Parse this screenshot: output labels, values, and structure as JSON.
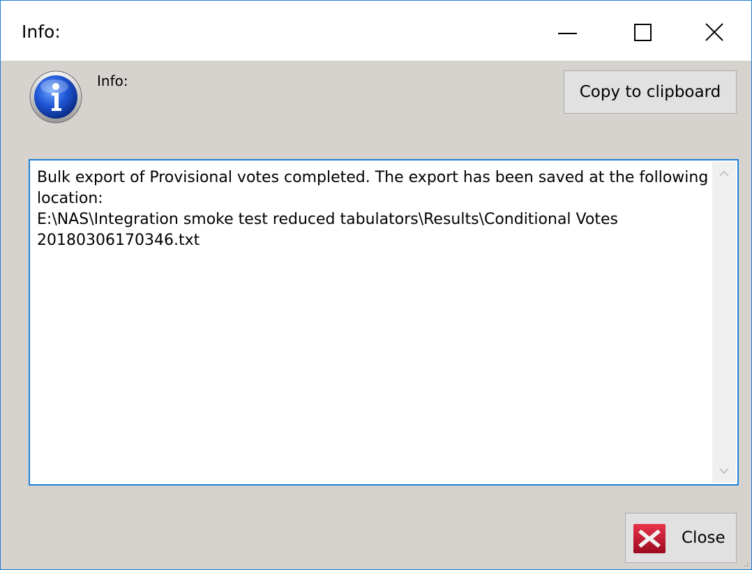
{
  "window": {
    "title": "Info:"
  },
  "window_controls": {
    "minimize_icon": "minimize-icon",
    "maximize_icon": "maximize-icon",
    "close_icon": "close-icon"
  },
  "header": {
    "icon": "info-icon",
    "label": "Info:"
  },
  "toolbar": {
    "copy_label": "Copy to clipboard"
  },
  "message": {
    "text": "Bulk export of Provisional votes completed. The export has been saved at the following location:\nE:\\NAS\\Integration smoke test reduced tabulators\\Results\\Conditional Votes 20180306170346.txt"
  },
  "footer": {
    "close_icon": "red-x-icon",
    "close_label": "Close"
  },
  "colors": {
    "accent": "#1e7fd6",
    "dialog_bg": "#d6d3ce",
    "button_bg": "#e1e1e1",
    "close_icon_red": "#c8102e"
  }
}
